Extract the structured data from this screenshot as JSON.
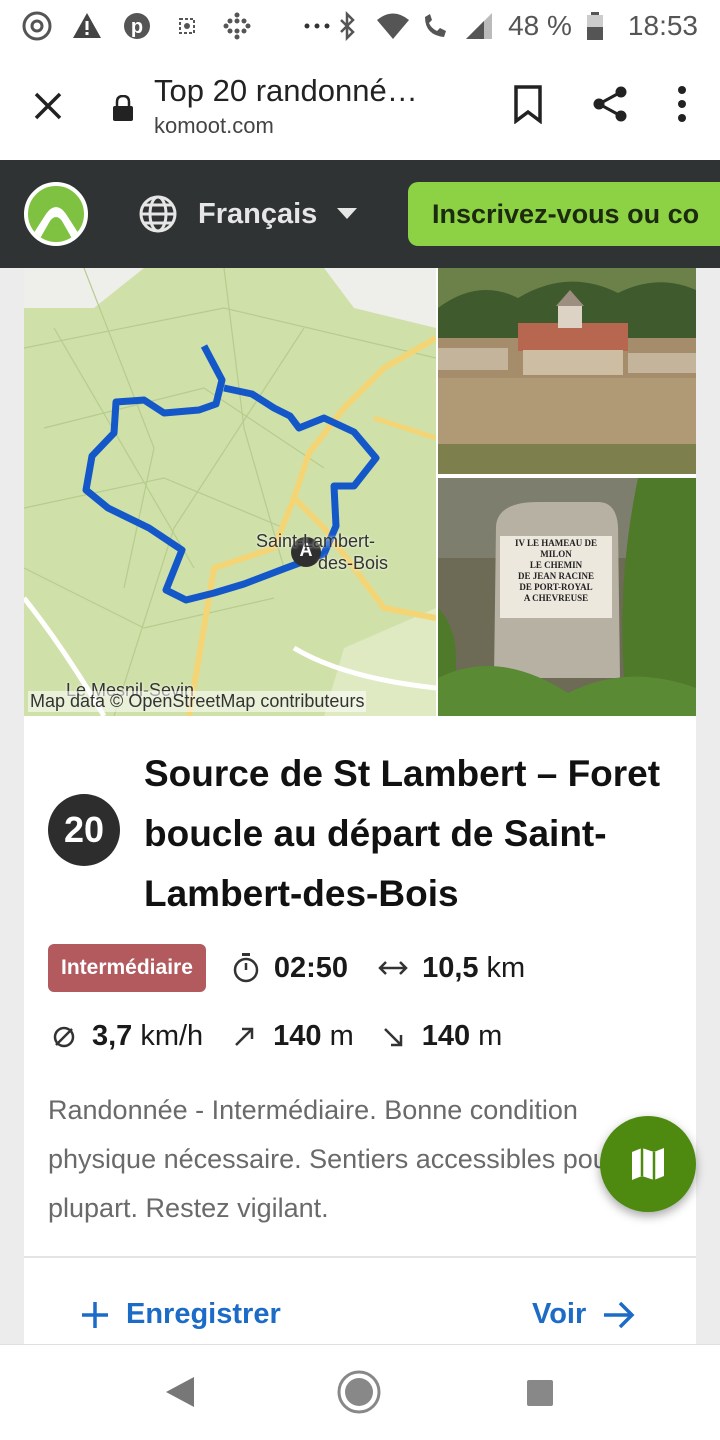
{
  "status_bar": {
    "icons_left": [
      "chrome-icon",
      "warning-icon",
      "pinterest-icon",
      "sync-icon",
      "dots-grid-icon",
      "more-dots-icon"
    ],
    "icons_right": [
      "bluetooth-icon",
      "wifi-icon",
      "call-wifi-icon",
      "signal-icon",
      "battery-icon"
    ],
    "battery": "48 %",
    "time": "18:53"
  },
  "browser": {
    "page_title": "Top 20 randonné…",
    "url": "komoot.com"
  },
  "komoot_header": {
    "language": "Français",
    "signup_label": "Inscrivez-vous ou co"
  },
  "tour": {
    "map_credit": "Map data © OpenStreetMap contributeurs",
    "map_place": "Saint-Lambert-des-Bois",
    "map_place_line1": "Saint-Lambert-",
    "map_place_line2": "des-Bois",
    "map_village": "Le Mesnil-Sevin",
    "start_marker": "A",
    "stone_sign": [
      "IV LE HAMEAU DE MILON",
      "LE CHEMIN",
      "DE JEAN RACINE",
      "DE PORT-ROYAL",
      "A CHEVREUSE"
    ],
    "rank": "20",
    "title": "Source de St Lambert – Foret boucle au départ de Saint-Lambert-des-Bois",
    "difficulty": "Intermédiaire",
    "duration": "02:50",
    "distance_value": "10,5",
    "distance_unit": "km",
    "speed_value": "3,7",
    "speed_unit": "km/h",
    "uphill_value": "140",
    "uphill_unit": "m",
    "downhill_value": "140",
    "downhill_unit": "m",
    "description": "Randonnée - Intermédiaire. Bonne condition physique nécessaire. Sentiers accessibles pour la plupart. Restez vigilant.",
    "save_label": "Enregistrer",
    "view_label": "Voir"
  },
  "colors": {
    "komoot_green": "#8dd145",
    "route_blue": "#1457c8",
    "difficulty_red": "#b35a5f",
    "link_blue": "#1c6bc7",
    "fab_green": "#4f8a10"
  }
}
